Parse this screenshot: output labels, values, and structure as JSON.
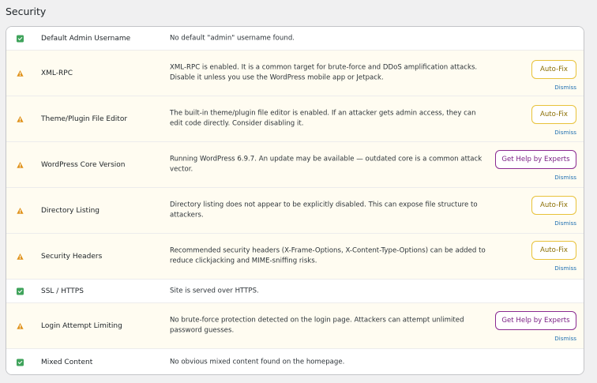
{
  "section": {
    "title": "Security"
  },
  "colors": {
    "ok_green": "#3fa35b",
    "warn_orange": "#e0921b",
    "warn_row_bg": "#fffcf1",
    "autofix_border": "#e8c23a",
    "experts_border": "#8a2a91",
    "link_blue": "#2271b1"
  },
  "rows": [
    {
      "status": "ok",
      "status_icon": "check-icon",
      "label": "Default Admin Username",
      "description": "No default \"admin\" username found."
    },
    {
      "status": "warning",
      "status_icon": "warning-icon",
      "label": "XML-RPC",
      "description": "XML-RPC is enabled. It is a common target for brute-force and DDoS amplification attacks. Disable it unless you use the WordPress mobile app or Jetpack.",
      "action_label": "Auto-Fix",
      "dismiss_label": "Dismiss"
    },
    {
      "status": "warning",
      "status_icon": "warning-icon",
      "label": "Theme/Plugin File Editor",
      "description": "The built-in theme/plugin file editor is enabled. If an attacker gets admin access, they can edit code directly. Consider disabling it.",
      "action_label": "Auto-Fix",
      "dismiss_label": "Dismiss"
    },
    {
      "status": "warning",
      "status_icon": "warning-icon",
      "label": "WordPress Core Version",
      "description": "Running WordPress 6.9.7. An update may be available — outdated core is a common attack vector.",
      "action_label": "Get Help by Experts",
      "dismiss_label": "Dismiss"
    },
    {
      "status": "warning",
      "status_icon": "warning-icon",
      "label": "Directory Listing",
      "description": "Directory listing does not appear to be explicitly disabled. This can expose file structure to attackers.",
      "action_label": "Auto-Fix",
      "dismiss_label": "Dismiss"
    },
    {
      "status": "warning",
      "status_icon": "warning-icon",
      "label": "Security Headers",
      "description": "Recommended security headers (X-Frame-Options, X-Content-Type-Options) can be added to reduce clickjacking and MIME-sniffing risks.",
      "action_label": "Auto-Fix",
      "dismiss_label": "Dismiss"
    },
    {
      "status": "ok",
      "status_icon": "check-icon",
      "label": "SSL / HTTPS",
      "description": "Site is served over HTTPS."
    },
    {
      "status": "warning",
      "status_icon": "warning-icon",
      "label": "Login Attempt Limiting",
      "description": "No brute-force protection detected on the login page. Attackers can attempt unlimited password guesses.",
      "action_label": "Get Help by Experts",
      "dismiss_label": "Dismiss"
    },
    {
      "status": "ok",
      "status_icon": "check-icon",
      "label": "Mixed Content",
      "description": "No obvious mixed content found on the homepage."
    }
  ]
}
